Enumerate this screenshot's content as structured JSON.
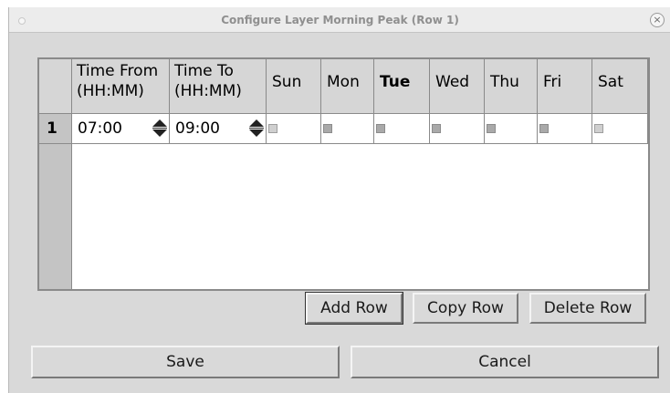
{
  "window": {
    "title": "Configure Layer Morning Peak (Row 1)",
    "close_glyph": "×"
  },
  "grid": {
    "columns": [
      {
        "key": "time_from",
        "label": "Time From\n(HH:MM)",
        "bold": false
      },
      {
        "key": "time_to",
        "label": "Time To\n(HH:MM)",
        "bold": false
      },
      {
        "key": "sun",
        "label": "Sun",
        "bold": false
      },
      {
        "key": "mon",
        "label": "Mon",
        "bold": false
      },
      {
        "key": "tue",
        "label": "Tue",
        "bold": true
      },
      {
        "key": "wed",
        "label": "Wed",
        "bold": false
      },
      {
        "key": "thu",
        "label": "Thu",
        "bold": false
      },
      {
        "key": "fri",
        "label": "Fri",
        "bold": false
      },
      {
        "key": "sat",
        "label": "Sat",
        "bold": false
      }
    ],
    "rows": [
      {
        "number": "1",
        "time_from": "07:00",
        "time_to": "09:00",
        "days": {
          "sun": false,
          "mon": true,
          "tue": true,
          "wed": true,
          "thu": true,
          "fri": true,
          "sat": false
        }
      }
    ]
  },
  "buttons": {
    "add_row": "Add Row",
    "copy_row": "Copy Row",
    "delete_row": "Delete Row",
    "save": "Save",
    "cancel": "Cancel"
  },
  "icons": {
    "spinner": "up-down-spinner-icon",
    "close": "close-icon"
  }
}
